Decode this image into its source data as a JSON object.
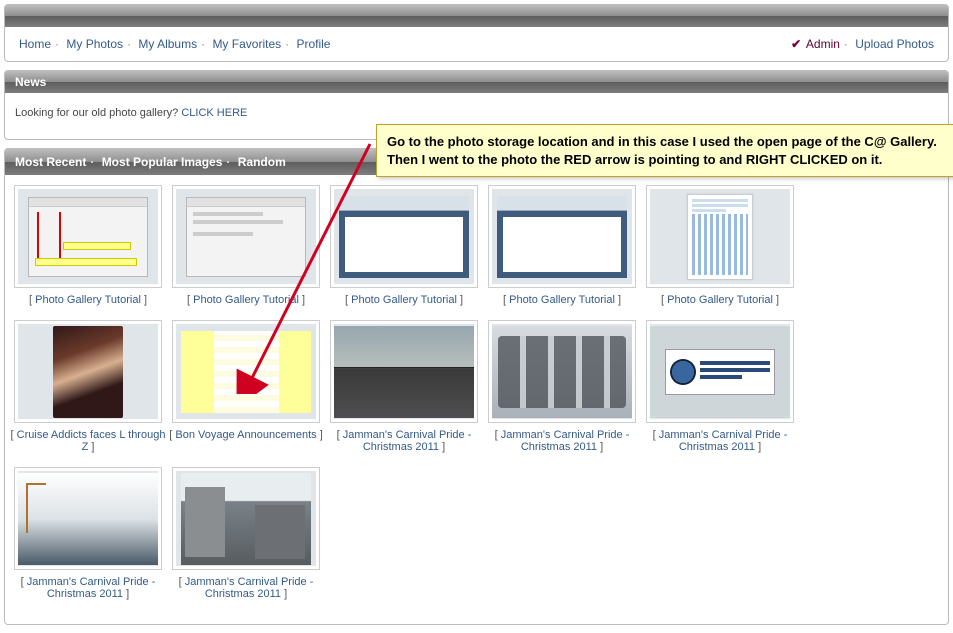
{
  "nav": {
    "home": "Home",
    "my_photos": "My Photos",
    "my_albums": "My Albums",
    "my_favorites": "My Favorites",
    "profile": "Profile",
    "admin": "Admin",
    "upload": "Upload Photos"
  },
  "news": {
    "header": "News",
    "text": "Looking for our old photo gallery?",
    "link": "CLICK HERE"
  },
  "callout": "Go to the photo storage location and in this case I used the open page of the C@ Gallery. Then I went to the photo the RED arrow is pointing to and RIGHT CLICKED on it.",
  "gallery": {
    "tabs": {
      "recent": "Most Recent",
      "popular": "Most Popular Images",
      "random": "Random"
    },
    "items": [
      {
        "label": "Photo Gallery Tutorial",
        "kind": "dialog_red"
      },
      {
        "label": "Photo Gallery Tutorial",
        "kind": "dialog_plain"
      },
      {
        "label": "Photo Gallery Tutorial",
        "kind": "browser"
      },
      {
        "label": "Photo Gallery Tutorial",
        "kind": "browser"
      },
      {
        "label": "Photo Gallery Tutorial",
        "kind": "page"
      },
      {
        "label": "Cruise Addicts faces L through Z",
        "kind": "portrait"
      },
      {
        "label": "Bon Voyage Announcements",
        "kind": "table"
      },
      {
        "label": "Jamman's Carnival Pride - Christmas 2011",
        "kind": "building"
      },
      {
        "label": "Jamman's Carnival Pride - Christmas 2011",
        "kind": "cars"
      },
      {
        "label": "Jamman's Carnival Pride - Christmas 2011",
        "kind": "banner"
      },
      {
        "label": "Jamman's Carnival Pride - Christmas 2011",
        "kind": "port"
      },
      {
        "label": "Jamman's Carnival Pride - Christmas 2011",
        "kind": "city"
      }
    ]
  }
}
